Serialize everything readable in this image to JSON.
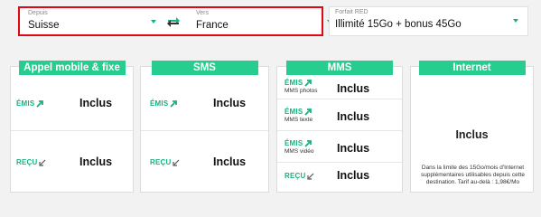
{
  "selectors": {
    "from": {
      "label": "Depuis",
      "value": "Suisse"
    },
    "to": {
      "label": "Vers",
      "value": "France"
    },
    "plan": {
      "label": "Forfait RED",
      "value": "Illimité 15Go + bonus 45Go"
    }
  },
  "cards": {
    "calls": {
      "title": "Appel mobile & fixe",
      "out_label": "ÉMIS",
      "out_value": "Inclus",
      "in_label": "REÇU",
      "in_value": "Inclus"
    },
    "sms": {
      "title": "SMS",
      "out_label": "ÉMIS",
      "out_value": "Inclus",
      "in_label": "REÇU",
      "in_value": "Inclus"
    },
    "mms": {
      "title": "MMS",
      "photo_label": "ÉMIS",
      "photo_sub": "MMS photos",
      "photo_value": "Inclus",
      "text_label": "ÉMIS",
      "text_sub": "MMS texte",
      "text_value": "Inclus",
      "video_label": "ÉMIS",
      "video_sub": "MMS vidéo",
      "video_value": "Inclus",
      "in_label": "REÇU",
      "in_value": "Inclus"
    },
    "internet": {
      "title": "Internet",
      "value": "Inclus",
      "note": "Dans la limite des 15Go/mois d'Internet supplémentaires utilisables depuis cette destination. Tarif au-delà : 1,98€/Mo"
    }
  },
  "colors": {
    "accent": "#27cc8f",
    "green_text": "#1ab27c",
    "red": "#e30613"
  }
}
